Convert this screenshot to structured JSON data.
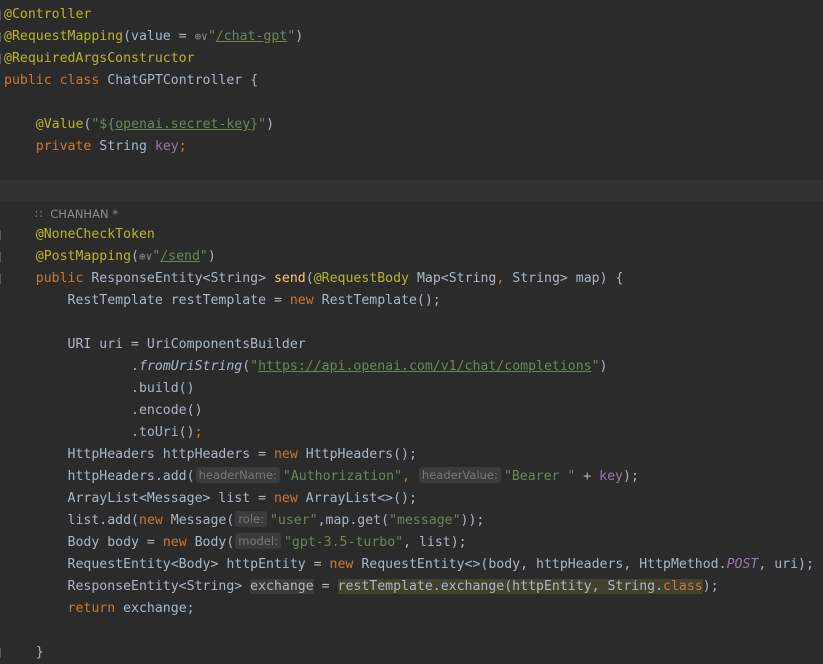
{
  "code": {
    "l1": {
      "annotation": "@Controller"
    },
    "l2": {
      "annotation": "@RequestMapping",
      "paren_open": "(value = ",
      "globe": "⊕∨",
      "str_q1": "\"",
      "path": "/chat-gpt",
      "str_q2": "\"",
      "paren_close": ")"
    },
    "l3": {
      "annotation": "@RequiredArgsConstructor"
    },
    "l4": {
      "kw1": "public",
      "kw2": "class",
      "name": "ChatGPTController",
      "brace": "{"
    },
    "l6": {
      "annotation": "@Value",
      "open": "(",
      "q1": "\"${",
      "prop": "openai.secret-key",
      "q2": "}\"",
      "close": ")"
    },
    "l7": {
      "kw": "private",
      "type": "String",
      "field": "key",
      "semi": ";"
    },
    "author_line": {
      "icon": "∷",
      "text": "CHANHAN *"
    },
    "l10": {
      "annotation": "@NoneCheckToken"
    },
    "l11": {
      "annotation": "@PostMapping",
      "open": "(",
      "globe": "⊕∨",
      "q1": "\"",
      "path": "/send",
      "q2": "\"",
      "close": ")"
    },
    "l12": {
      "kw": "public",
      "ret": "ResponseEntity<String>",
      "method": "send",
      "open": "(",
      "ann": "@RequestBody",
      "ptype": "Map<String",
      "comma": ",",
      "ptype2": "String> map)",
      "brace": "{"
    },
    "l13": {
      "decl": "RestTemplate restTemplate = ",
      "kw": "new",
      "rest": "RestTemplate();"
    },
    "l15": {
      "text": "URI uri = UriComponentsBuilder"
    },
    "l16": {
      "dot": ".",
      "method": "fromUriString",
      "open": "(",
      "q1": "\"",
      "url": "https://api.openai.com/v1/chat/completions",
      "q2": "\"",
      "close": ")"
    },
    "l17": {
      "text": ".build()"
    },
    "l18": {
      "text": ".encode()"
    },
    "l19": {
      "text": ".toUri()",
      "semi": ";"
    },
    "l20": {
      "decl": "HttpHeaders httpHeaders = ",
      "kw": "new",
      "rest": "HttpHeaders();"
    },
    "l21": {
      "call": "httpHeaders.add(",
      "hint1": "headerName:",
      "arg1": "\"Authorization\"",
      "comma": ",",
      "hint2": "headerValue:",
      "arg2": "\"Bearer \"",
      "plus": " + ",
      "field": "key",
      "close": ");"
    },
    "l22": {
      "decl": "ArrayList<Message> list = ",
      "kw": "new",
      "rest": "ArrayList<>();"
    },
    "l23": {
      "call": "list.add(",
      "kw": "new",
      "ctor": "Message(",
      "hint": "role:",
      "arg": "\"user\"",
      "mid": ",map.get(",
      "arg2": "\"message\"",
      "close": "));"
    },
    "l24": {
      "decl": "Body body = ",
      "kw": "new",
      "ctor": "Body(",
      "hint": "model:",
      "arg": "\"gpt-3.5-turbo\"",
      "rest": ", list);"
    },
    "l25": {
      "decl": "RequestEntity<Body> httpEntity = ",
      "kw": "new",
      "ctor": "RequestEntity<>(body, httpHeaders, HttpMethod.",
      "const": "POST",
      "rest": ", uri);"
    },
    "l26": {
      "type": "ResponseEntity<String> ",
      "var": "exchange",
      "eq": " = ",
      "call": "restTemplate.exchange(httpEntity, String.",
      "kw": "class",
      "close": ");"
    },
    "l27": {
      "kw": "return",
      "rest": " exchange;"
    },
    "l29": {
      "brace": "}"
    }
  }
}
